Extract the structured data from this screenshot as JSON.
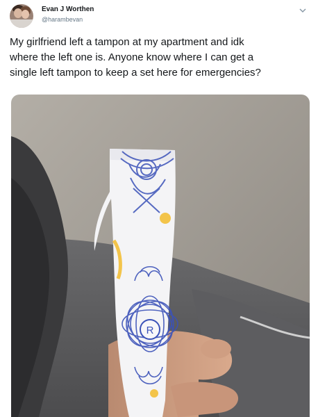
{
  "tweet": {
    "author_name": "Evan J Worthen",
    "author_handle": "@harambevan",
    "text_lines": [
      "My girlfriend left a tampon at my apartment and idk",
      "where the left one is. Anyone know where I can get a",
      "single left tampon to keep a set here for emergencies?"
    ],
    "wrapper_letter": "R"
  },
  "icons": {
    "more_menu": "chevron-down-icon"
  },
  "colors": {
    "text": "#14171a",
    "secondary_text": "#657786",
    "pattern_blue": "#3b52b8",
    "pattern_yellow": "#f3c44a"
  }
}
